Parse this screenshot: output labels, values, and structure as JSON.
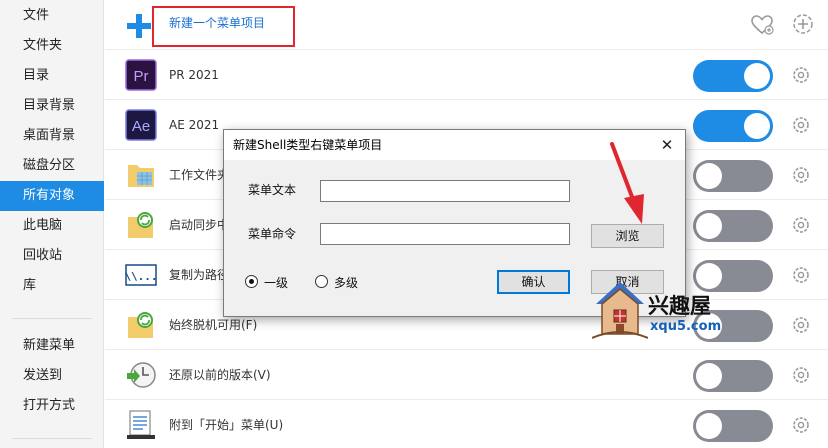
{
  "sidebar": {
    "items": [
      "文件",
      "文件夹",
      "目录",
      "目录背景",
      "桌面背景",
      "磁盘分区",
      "所有对象",
      "此电脑",
      "回收站",
      "库"
    ],
    "items2": [
      "新建菜单",
      "发送到",
      "打开方式"
    ],
    "active": "所有对象"
  },
  "list": {
    "new_item_label": "新建一个菜单项目",
    "rows": [
      {
        "label": "PR 2021",
        "enabled": true,
        "icon": "premiere-pro-icon"
      },
      {
        "label": "AE 2021",
        "enabled": true,
        "icon": "after-effects-icon"
      },
      {
        "label": "工作文件夹",
        "enabled": false,
        "icon": "work-folder-icon"
      },
      {
        "label": "启动同步中心",
        "enabled": false,
        "icon": "sync-folder-icon"
      },
      {
        "label": "复制为路径",
        "enabled": false,
        "icon": "copy-path-icon"
      },
      {
        "label": "始终脱机可用(F)",
        "enabled": false,
        "icon": "offline-sync-folder-icon"
      },
      {
        "label": "还原以前的版本(V)",
        "enabled": false,
        "icon": "restore-clock-icon"
      },
      {
        "label": "附到「开始」菜单(U)",
        "enabled": false,
        "icon": "pin-start-icon"
      }
    ]
  },
  "dialog": {
    "title": "新建Shell类型右键菜单项目",
    "text_label": "菜单文本",
    "text_value": "",
    "command_label": "菜单命令",
    "command_value": "",
    "browse_label": "浏览",
    "radio_level1": "一级",
    "radio_multi": "多级",
    "selected_level": "一级",
    "ok_label": "确认",
    "cancel_label": "取消"
  },
  "watermark": {
    "name": "兴趣屋",
    "site": "xqu5.com"
  },
  "colors": {
    "accent": "#1e8be4",
    "toggle_off": "#888a94",
    "highlight_box": "#e0262f",
    "annotation_arrow": "#e0262f"
  }
}
